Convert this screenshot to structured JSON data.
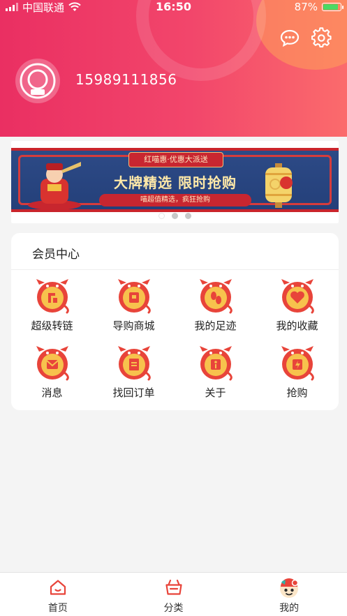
{
  "status_bar": {
    "carrier": "中国联通",
    "time": "16:50",
    "battery": "87%"
  },
  "header": {
    "phone": "15989111856"
  },
  "banner": {
    "tag": "红喵惠·优惠大派送",
    "title": "大牌精选  限时抢购",
    "subtitle": "喵超值精选，疯狂抢购",
    "page_count": 3,
    "active_index": 0
  },
  "member_center": {
    "title": "会员中心",
    "items": [
      {
        "label": "超级转链",
        "icon": "super-link-icon"
      },
      {
        "label": "导购商城",
        "icon": "shopping-mall-icon"
      },
      {
        "label": "我的足迹",
        "icon": "footprint-icon"
      },
      {
        "label": "我的收藏",
        "icon": "favorites-icon"
      },
      {
        "label": "消息",
        "icon": "message-icon"
      },
      {
        "label": "找回订单",
        "icon": "retrieve-order-icon"
      },
      {
        "label": "关于",
        "icon": "about-icon"
      },
      {
        "label": "抢购",
        "icon": "flash-sale-icon"
      }
    ]
  },
  "tabbar": {
    "tabs": [
      {
        "label": "首页",
        "icon": "home-icon"
      },
      {
        "label": "分类",
        "icon": "category-basket-icon"
      },
      {
        "label": "我的",
        "icon": "profile-icon"
      }
    ],
    "active": 2
  },
  "colors": {
    "header_start": "#ea2f62",
    "header_end": "#fb6b6c",
    "accent": "#e8443a"
  }
}
